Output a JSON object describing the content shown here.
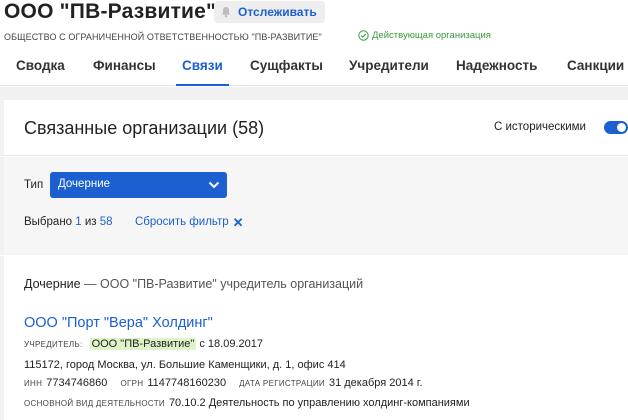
{
  "header": {
    "company_title": "ООО \"ПВ-Развитие\"",
    "follow_label": "Отслеживать",
    "legal_name": "ОБЩЕСТВО С ОГРАНИЧЕННОЙ ОТВЕТСТВЕННОСТЬЮ \"ПВ-РАЗВИТИЕ\"",
    "status": "Действующая организация"
  },
  "tabs": [
    {
      "label": "Сводка"
    },
    {
      "label": "Финансы"
    },
    {
      "label": "Связи",
      "active": true
    },
    {
      "label": "Сущфакты"
    },
    {
      "label": "Учредители"
    },
    {
      "label": "Надежность"
    },
    {
      "label": "Санкции"
    }
  ],
  "card": {
    "title": "Связанные организации (58)",
    "historical_label": "С историческими",
    "historical_enabled": true
  },
  "filter": {
    "type_label": "Тип",
    "type_value": "Дочерние",
    "selected_prefix": "Выбрано",
    "selected_count": "1",
    "selected_of": "из",
    "selected_total": "58",
    "reset_label": "Сбросить фильтр"
  },
  "section": {
    "title_strong": "Дочерние",
    "title_rest": " — ООО \"ПВ-Развитие\" учредитель организаций"
  },
  "org": {
    "name": "ООО \"Порт \"Вера\" Холдинг\"",
    "founder_caption": "УЧРЕДИТЕЛЬ:",
    "founder_name": "ООО \"ПВ-Развитие\"",
    "founder_since": "с 18.09.2017",
    "address": "115172, город Москва, ул. Большие Каменщики, д. 1, офис 414",
    "inn_caption": "ИНН",
    "inn": "7734746860",
    "ogrn_caption": "ОГРН",
    "ogrn": "1147748160230",
    "reg_caption": "ДАТА РЕГИСТРАЦИИ",
    "reg_date": "31 декабря 2014 г.",
    "activity_caption": "ОСНОВНОЙ ВИД ДЕЯТЕЛЬНОСТИ",
    "activity": "70.10.2 Деятельность по управлению холдинг-компаниями"
  },
  "colors": {
    "accent": "#1c5fd0",
    "status_green": "#3a9a3a",
    "highlight": "#dff3c8"
  },
  "icons": {
    "follow": "bell-icon",
    "status": "check-circle-icon",
    "select": "chevron-down-icon",
    "reset": "close-icon"
  }
}
